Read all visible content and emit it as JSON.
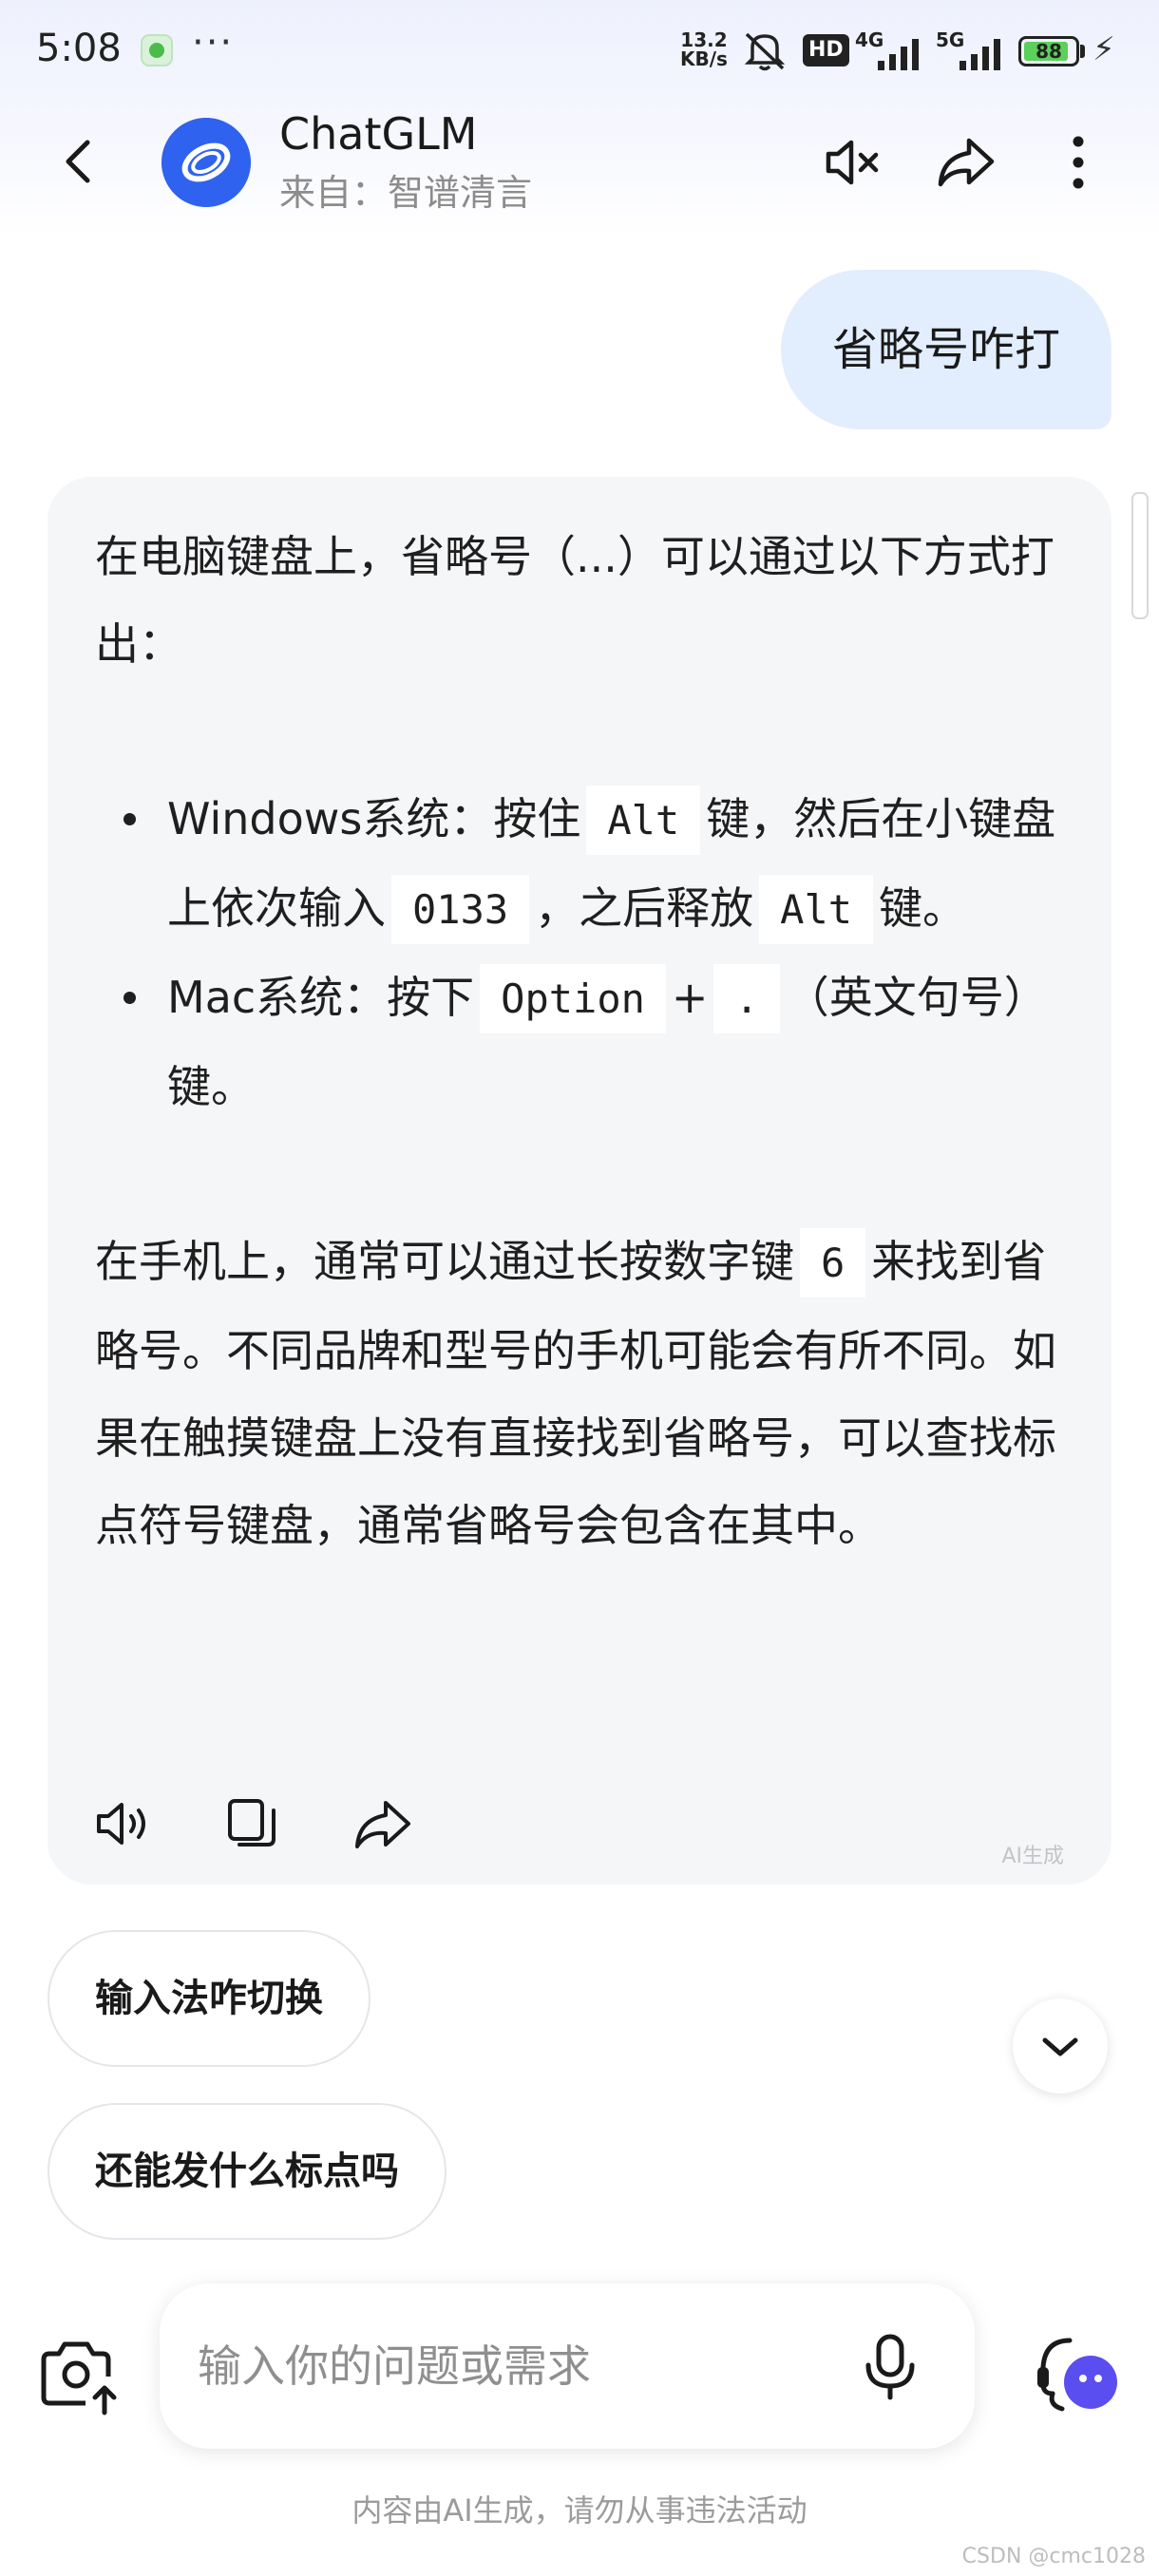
{
  "status_bar": {
    "time": "5:08",
    "more": "···",
    "net_speed": "13.2",
    "net_unit": "KB/s",
    "hd_label": "HD",
    "signal1_label": "4G",
    "signal2_label": "5G",
    "battery": "88",
    "battery_level": 0.88
  },
  "header": {
    "title": "ChatGLM",
    "subtitle": "来自：智谱清言"
  },
  "user_message": "省略号咋打",
  "answer": {
    "intro": "在电脑键盘上，省略号（...）可以通过以下方式打出：",
    "windows": {
      "t1": "Windows系统：按住",
      "k1": "Alt",
      "t2": "键，然后在小键盘上依次输入",
      "k2": "0133",
      "t3": "，之后释放",
      "k3": "Alt",
      "t4": "键。"
    },
    "mac": {
      "t1": "Mac系统：按下",
      "k1": "Option",
      "t2": "+",
      "k2": ".",
      "t3": "（英文句号）键。"
    },
    "mobile": {
      "t1": "在手机上，通常可以通过长按数字键",
      "k1": "6",
      "t2": "来找到省略号。不同品牌和型号的手机可能会有所不同。如果在触摸键盘上没有直接找到省略号，可以查找标点符号键盘，通常省略号会包含在其中。"
    },
    "ai_label": "AI生成"
  },
  "suggestions": [
    "输入法咋切换",
    "还能发什么标点吗"
  ],
  "input": {
    "placeholder": "输入你的问题或需求"
  },
  "disclaimer": "内容由AI生成，请勿从事违法活动",
  "watermark": "CSDN @cmc1028",
  "colors": {
    "accent": "#2f62ee",
    "user_bubble": "#e2eefe",
    "card_bg": "#f5f6f8"
  }
}
